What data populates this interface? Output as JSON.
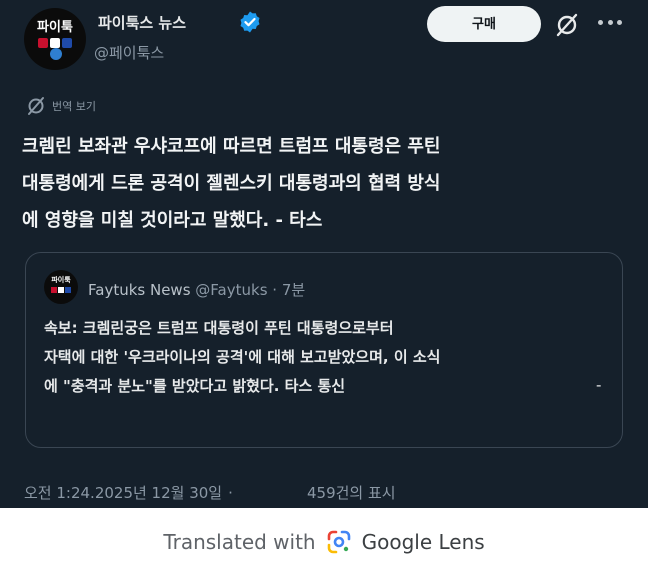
{
  "author": {
    "avatar_text": "파이툭",
    "display_name": "파이툭스 뉴스",
    "handle": "@페이툭스",
    "verified_color": "#1d9bf0"
  },
  "header": {
    "buy_label": "구매"
  },
  "translate": {
    "label": "번역 보기"
  },
  "post": {
    "lines": [
      "크렘린 보좌관 우샤코프에 따르면 트럼프 대통령은 푸틴",
      "대통령에게 드론 공격이 젤렌스키 대통령과의 협력 방식",
      "에 영향을 미칠 것이라고 말했다. - 타스"
    ]
  },
  "quote": {
    "avatar_text": "파이툭",
    "name": "Faytuks News",
    "handle": "@Faytuks",
    "time": "7분",
    "lines": [
      "속보: 크렘린궁은 트럼프 대통령이 푸틴 대통령으로부터",
      "자택에 대한 '우크라이나의 공격'에 대해 보고받았으며, 이 소식",
      "에 \"충격과 분노\"를 받았다고 밝혔다. 타스 통신"
    ],
    "trailing": "-"
  },
  "footer": {
    "timestamp": "오전 1:24.2025년 12월 30일",
    "separator": "·",
    "views": "459건의 표시"
  },
  "lens": {
    "prefix": "Translated with",
    "brand": "Google Lens"
  },
  "colors": {
    "background": "#15202b",
    "accent": "#1d9bf0",
    "muted": "#8b98a5",
    "lens_blue": "#4285f4",
    "lens_red": "#ea4335",
    "lens_yellow": "#fbbc05",
    "lens_green": "#34a853"
  }
}
